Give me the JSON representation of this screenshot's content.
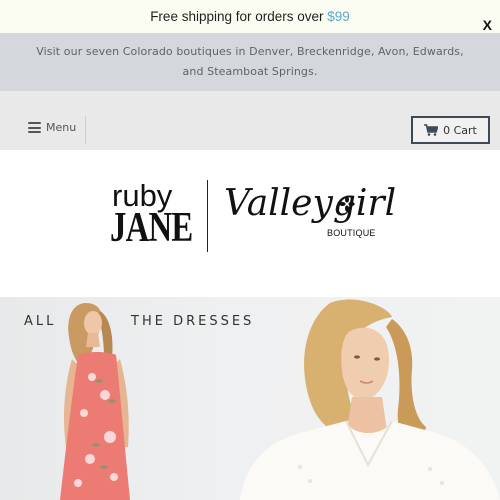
{
  "promo": {
    "text": "Free shipping for orders over ",
    "amount": "$99",
    "close_label": "X"
  },
  "announcement": {
    "text": "Visit our seven Colorado boutiques in Denver, Breckenridge, Avon, Edwards, and Steamboat Springs."
  },
  "nav": {
    "menu_label": "Menu",
    "cart_label": "0 Cart"
  },
  "logo": {
    "brand_top": "ruby",
    "brand_bottom": "JANE",
    "partner_script": "Valleygirl",
    "partner_sub": "BOUTIQUE"
  },
  "hero": {
    "headline_left": "ALL",
    "headline_right": "THE DRESSES"
  },
  "colors": {
    "promo_bg": "#fbfdf3",
    "promo_accent": "#5aa9c9",
    "announce_bg": "#d4d8dc",
    "nav_bg": "#e9e9ea",
    "cart_border": "#3f4a56",
    "dress": "#ec7b74"
  },
  "icons": {
    "menu": "hamburger-icon",
    "cart": "shopping-cart-icon",
    "close": "close-icon"
  }
}
